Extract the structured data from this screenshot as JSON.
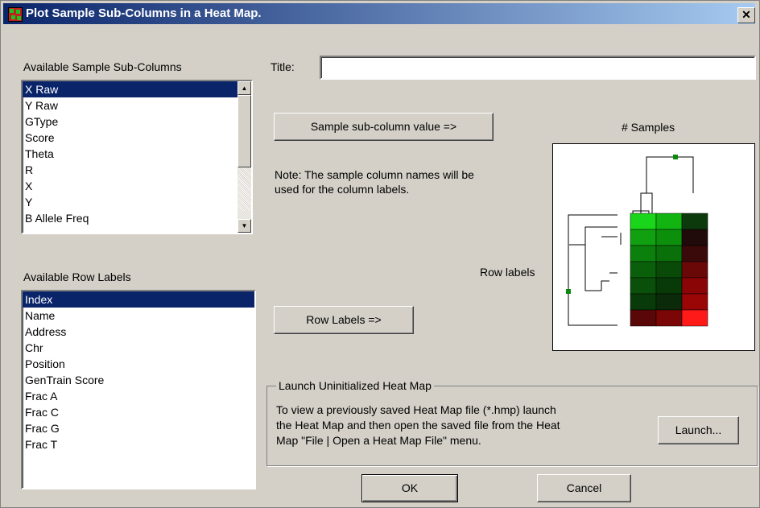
{
  "window": {
    "title": "Plot Sample Sub-Columns in a Heat Map.",
    "close_symbol": "✕"
  },
  "sub_columns": {
    "label": "Available Sample Sub-Columns",
    "items": [
      "X Raw",
      "Y Raw",
      "GType",
      "Score",
      "Theta",
      "R",
      "X",
      "Y",
      "B Allele Freq"
    ],
    "selected": "X Raw"
  },
  "row_labels": {
    "label": "Available Row Labels",
    "items": [
      "Index",
      "Name",
      "Address",
      "Chr",
      "Position",
      "GenTrain Score",
      "Frac A",
      "Frac C",
      "Frac G",
      "Frac T"
    ],
    "selected": "Index"
  },
  "title_field": {
    "label": "Title:",
    "value": ""
  },
  "sample_button": "Sample sub-column value =>",
  "note": "Note: The sample column names will be\nused for the column labels.",
  "row_labels_button": "Row Labels =>",
  "preview": {
    "samples_label": "# Samples",
    "row_labels_label": "Row labels",
    "heatmap_colors": [
      [
        "#1ad61a",
        "#11b411",
        "#0c3a0c"
      ],
      [
        "#10a010",
        "#0c900c",
        "#200a0a"
      ],
      [
        "#0c800c",
        "#0a700a",
        "#3a0a0a"
      ],
      [
        "#0a600a",
        "#094a09",
        "#6a0808"
      ],
      [
        "#0a500a",
        "#083a08",
        "#8a0606"
      ],
      [
        "#093a09",
        "#0a2a0a",
        "#9a0505"
      ],
      [
        "#5a0707",
        "#7a0606",
        "#ff1a1a"
      ]
    ],
    "dendrogram_node_color": "#0a8a0a"
  },
  "launch_group": {
    "title": "Launch Uninitialized Heat Map",
    "description": "To view a previously saved Heat Map file (*.hmp) launch\nthe Heat Map and then open the saved file from the Heat\nMap \"File | Open a Heat Map File\" menu.",
    "launch_button": "Launch..."
  },
  "footer": {
    "ok": "OK",
    "cancel": "Cancel"
  },
  "colors": {
    "title_start": "#0a246a",
    "title_end": "#a6caf0",
    "selection": "#0a246a",
    "face": "#d4d0c8"
  }
}
